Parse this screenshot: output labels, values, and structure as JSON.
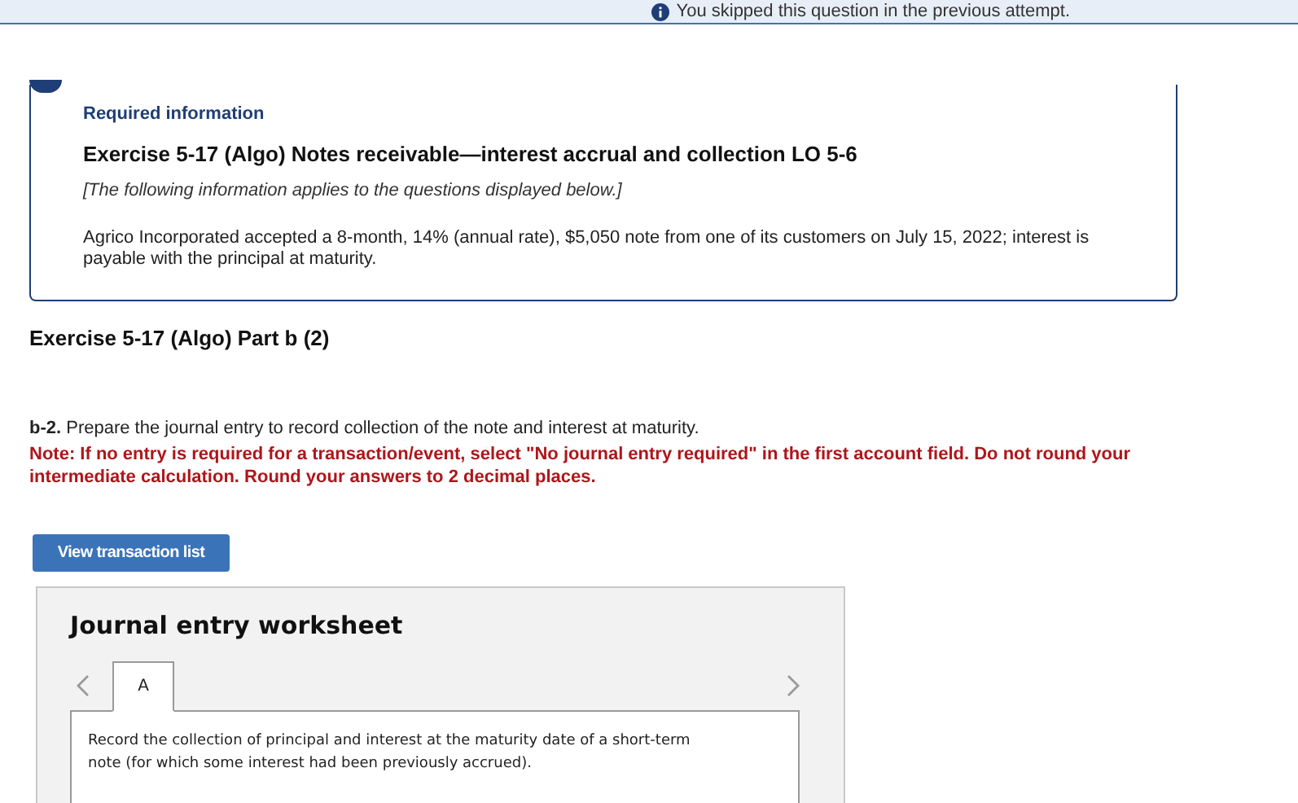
{
  "banner": {
    "text": "You skipped this question in the previous attempt."
  },
  "info": {
    "label": "Required information",
    "title": "Exercise 5-17 (Algo) Notes receivable—interest accrual and collection LO 5-6",
    "subtitle": "[The following information applies to the questions displayed below.]",
    "body": "Agrico Incorporated accepted a 8-month, 14% (annual rate), $5,050 note from one of its customers on July 15, 2022; interest is payable with the principal at maturity."
  },
  "part_heading": "Exercise 5-17 (Algo) Part b (2)",
  "question": "**b-2.** Prepare the journal entry to record collection of the note and interest at maturity.",
  "note": "Note: If no entry is required for a transaction/event, select \"No journal entry required\" in the first account field. Do not round your intermediate calculation. Round your answers to 2 decimal places.",
  "button": "View transaction list",
  "worksheet": {
    "title": "Journal entry worksheet",
    "tabs": [
      {
        "label": "A",
        "selected": true
      }
    ],
    "description": "Record the collection of principal and interest at the maturity date of a short-term note (for which some interest had been previously accrued)."
  }
}
